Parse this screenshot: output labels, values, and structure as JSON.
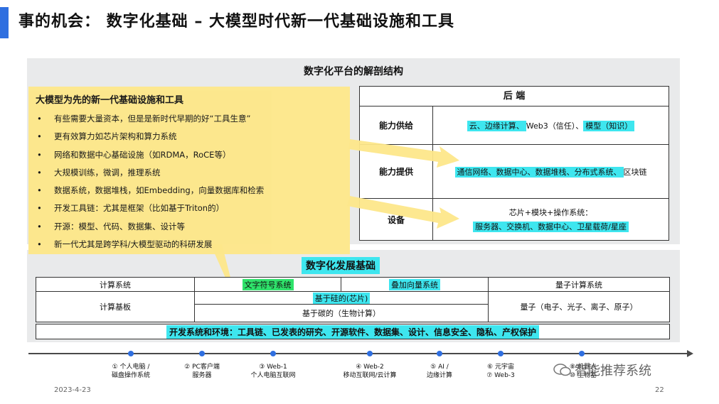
{
  "title": "事的机会： 数字化基础 – 大模型时代新一代基础设施和工具",
  "panel_title": "数字化平台的解剖结构",
  "note": {
    "title": "大模型为先的新一代基础设施和工具",
    "items": [
      "有些需要大量资本，但是是新时代早期的好“工具生意”",
      "更有效算力如芯片架构和算力系统",
      "网络和数据中心基础设施（如RDMA，RoCE等）",
      "大规模训练，微调，推理系统",
      "数据系统，数据堆栈，如Embedding，向量数据库和检索",
      "开发工具链：尤其是框架（比如基于Triton的）",
      "开源：模型、代码、数据集、设计等",
      "新一代尤其是跨学科/大模型驱动的科研发展"
    ]
  },
  "backend": {
    "header": "后  端",
    "rows": [
      {
        "label": "能力供给",
        "hl": "云、边缘计算、",
        "plain": "Web3（信任）、",
        "hl2": "模型（知识）"
      },
      {
        "label": "能力提供",
        "hl": "通信网络、数据中心、数据堆栈、分布式系统、",
        "plain": "区块链"
      },
      {
        "label": "设备",
        "line1": "芯片+模块+操作系统：",
        "hl": "服务器、交换机、数据中心、卫星载荷/星座"
      }
    ]
  },
  "foundation": {
    "title": "数字化发展基础",
    "c1_top": "计算系统",
    "c1_bottom": "计算基板",
    "c2": "文字符号系统",
    "c3": "叠加向量系统",
    "silicon": "基于硅的(芯片)",
    "carbon": "基于碳的（生物计算）",
    "c4_top": "量子计算系统",
    "c4_bottom": "量子（电子、光子、离子、原子）",
    "bar": "开发系统和环境：工具链、已发表的研究、开源软件、数据集、设计、信息安全、隐私、产权保护"
  },
  "timeline": [
    {
      "line1": "① 个人电脑 /",
      "line2": "磁盘操作系统"
    },
    {
      "line1": "② PC客户端",
      "line2": "服务器"
    },
    {
      "line1": "③ Web-1",
      "line2": "个人电脑互联网"
    },
    {
      "line1": "④ Web-2",
      "line2": "移动互联网/云计算"
    },
    {
      "line1": "⑤ AI /",
      "line2": "边缘计算"
    },
    {
      "line1": "⑥ 元宇宙",
      "line2": "⑦ Web-3"
    },
    {
      "line1": "⑧ 机器人",
      "line2": "⑩ 生物基"
    }
  ],
  "footer": {
    "date": "2023-4-23",
    "page": "22",
    "watermark": "智能推荐系统"
  },
  "colors": {
    "highlight": "#3ee6ef",
    "green": "#2fe36b",
    "note": "#fde78a",
    "accent": "#2f6fe0"
  }
}
